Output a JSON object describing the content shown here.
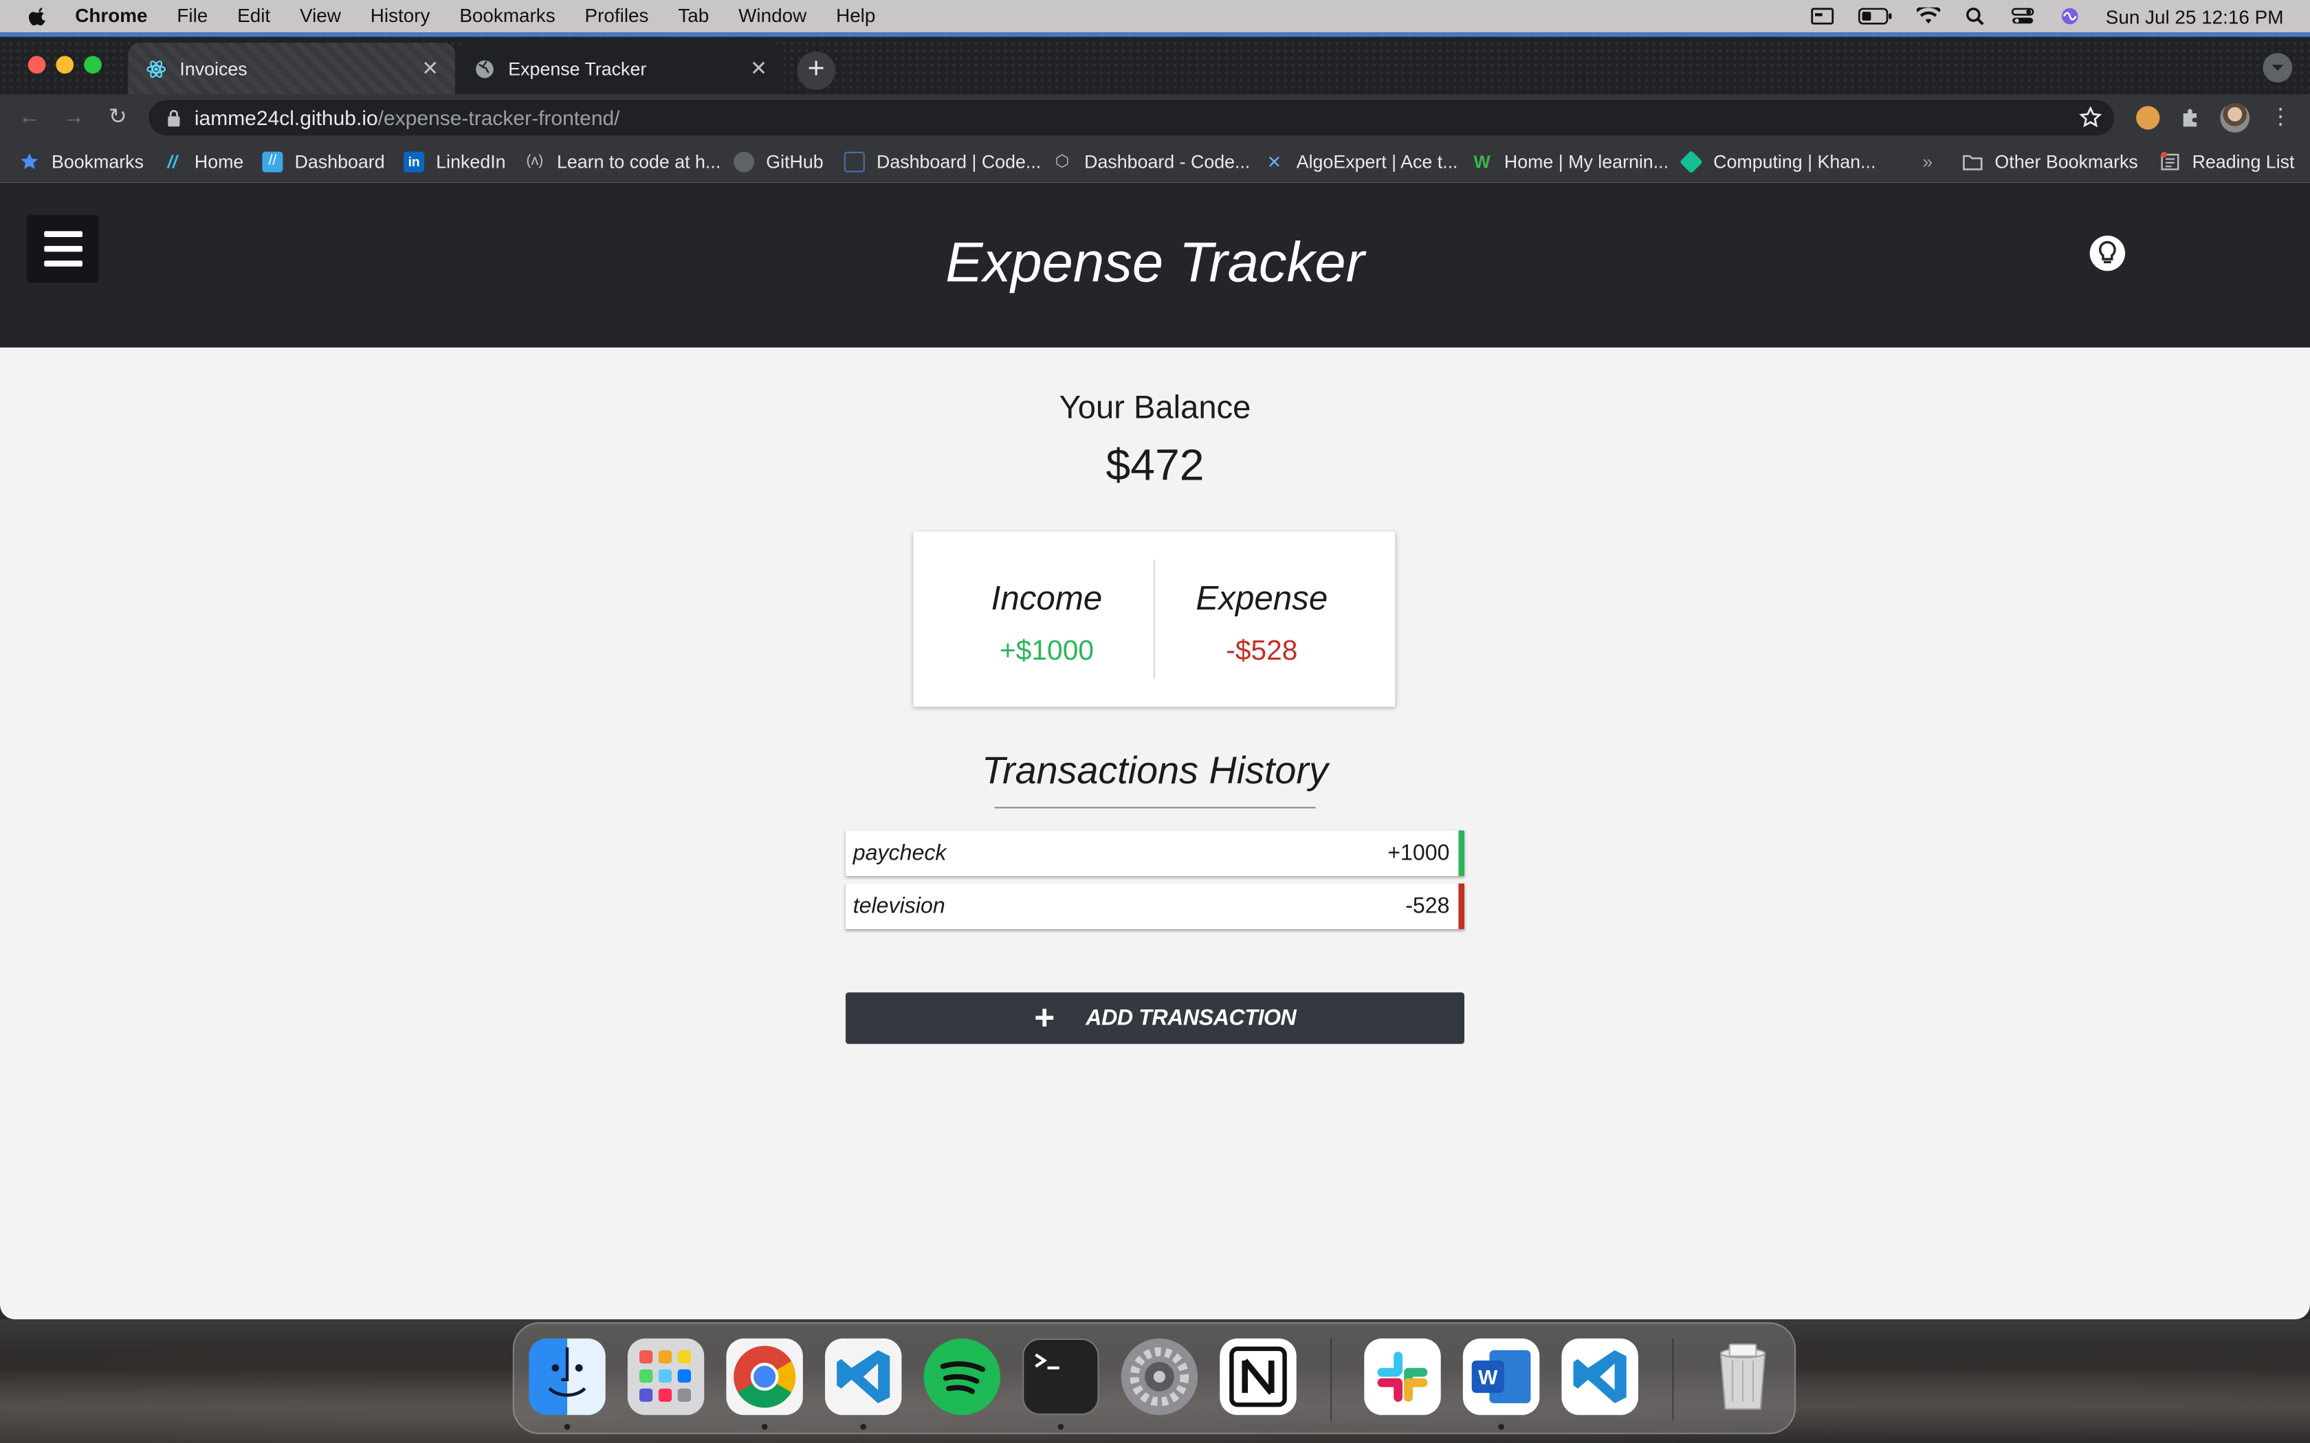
{
  "menubar": {
    "app": "Chrome",
    "items": [
      "File",
      "Edit",
      "View",
      "History",
      "Bookmarks",
      "Profiles",
      "Tab",
      "Window",
      "Help"
    ],
    "clock": "Sun Jul 25  12:16 PM"
  },
  "browser": {
    "tabs": [
      {
        "title": "Invoices"
      },
      {
        "title": "Expense Tracker"
      }
    ],
    "url_host": "iamme24cl.github.io",
    "url_path": "/expense-tracker-frontend/",
    "bookmarks": [
      {
        "label": "Bookmarks",
        "icon": "star-icon"
      },
      {
        "label": "Home",
        "icon": "slash-icon"
      },
      {
        "label": "Dashboard",
        "icon": "slash-icon"
      },
      {
        "label": "LinkedIn",
        "icon": "linkedin-icon"
      },
      {
        "label": "Learn to code at h...",
        "icon": "freecodecamp-icon"
      },
      {
        "label": "GitHub",
        "icon": "github-icon"
      },
      {
        "label": "Dashboard | Code...",
        "icon": "code-icon"
      },
      {
        "label": "Dashboard - Code...",
        "icon": "box-icon"
      },
      {
        "label": "AlgoExpert | Ace t...",
        "icon": "algoexpert-icon"
      },
      {
        "label": "Home | My learnin...",
        "icon": "w-icon"
      },
      {
        "label": "Computing | Khan...",
        "icon": "khan-icon"
      }
    ],
    "overflow": "»",
    "other_bookmarks": "Other Bookmarks",
    "reading_list": "Reading List"
  },
  "app": {
    "title": "Expense Tracker",
    "balance_label": "Your Balance",
    "balance": "$472",
    "income_label": "Income",
    "income": "+$1000",
    "expense_label": "Expense",
    "expense": "-$528",
    "history_title": "Transactions History",
    "transactions": [
      {
        "name": "paycheck",
        "amount": "+1000",
        "type": "income"
      },
      {
        "name": "television",
        "amount": "-528",
        "type": "expense"
      }
    ],
    "add_button_icon": "+",
    "add_button": "ADD TRANSACTION"
  },
  "colors": {
    "income": "#2ab55a",
    "expense": "#c22f23",
    "header": "#23252a",
    "button": "#343841"
  },
  "dock": [
    "finder-icon",
    "launchpad-icon",
    "chrome-icon",
    "vscode-icon",
    "spotify-icon",
    "terminal-icon",
    "system-preferences-icon",
    "notion-icon",
    "slack-icon",
    "word-icon",
    "vscode-icon",
    "trash-icon"
  ]
}
